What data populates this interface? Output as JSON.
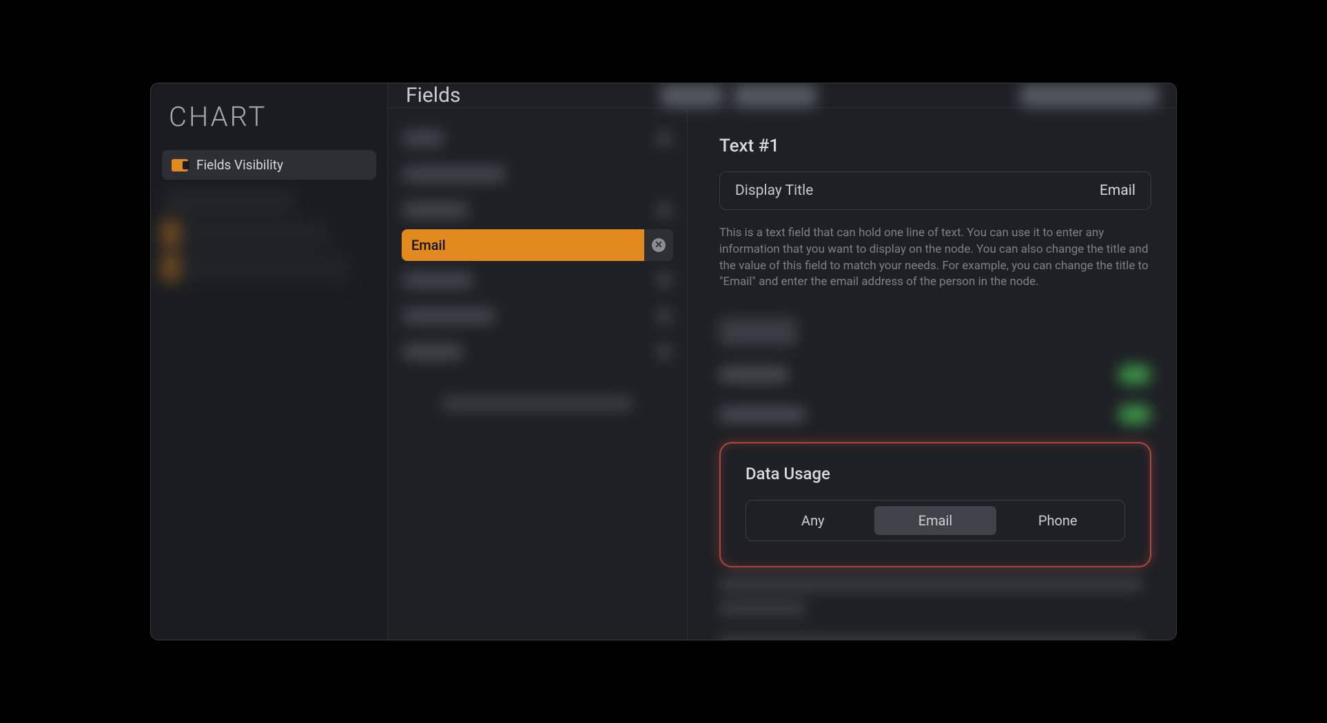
{
  "app": {
    "title": "CHART"
  },
  "sidebar": {
    "active_item": "Fields Visibility"
  },
  "topbar": {
    "title": "Fields"
  },
  "fields": {
    "selected": {
      "label": "Email"
    }
  },
  "detail": {
    "heading": "Text #1",
    "display_title_label": "Display Title",
    "display_title_value": "Email",
    "description": "This is a text field that can hold one line of text. You can use it to enter any information that you want to display on the node. You can also change the title and the value of this field to match your needs. For example, you can change the title to \"Email\" and enter the email address of the person in the node.",
    "data_usage": {
      "title": "Data Usage",
      "options": [
        "Any",
        "Email",
        "Phone"
      ],
      "selected": "Email"
    }
  }
}
